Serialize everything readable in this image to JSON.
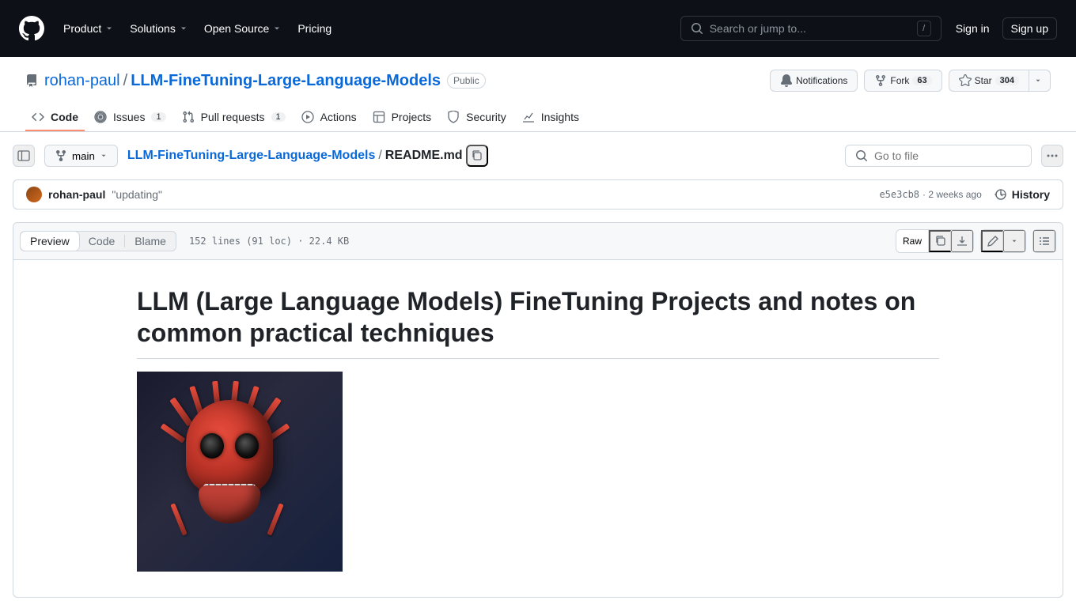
{
  "header": {
    "nav": [
      "Product",
      "Solutions",
      "Open Source",
      "Pricing"
    ],
    "search_placeholder": "Search or jump to...",
    "search_key": "/",
    "signin": "Sign in",
    "signup": "Sign up"
  },
  "repo": {
    "owner": "rohan-paul",
    "name": "LLM-FineTuning-Large-Language-Models",
    "visibility": "Public",
    "actions": {
      "notifications": "Notifications",
      "fork": "Fork",
      "fork_count": "63",
      "star": "Star",
      "star_count": "304"
    }
  },
  "tabs": [
    {
      "label": "Code",
      "icon": "code",
      "active": true
    },
    {
      "label": "Issues",
      "icon": "issue",
      "count": "1"
    },
    {
      "label": "Pull requests",
      "icon": "pr",
      "count": "1"
    },
    {
      "label": "Actions",
      "icon": "play"
    },
    {
      "label": "Projects",
      "icon": "table"
    },
    {
      "label": "Security",
      "icon": "shield"
    },
    {
      "label": "Insights",
      "icon": "graph"
    }
  ],
  "filenav": {
    "branch": "main",
    "breadcrumb_root": "LLM-FineTuning-Large-Language-Models",
    "breadcrumb_current": "README.md",
    "goto_placeholder": "Go to file"
  },
  "commit": {
    "author": "rohan-paul",
    "message": "\"updating\"",
    "sha": "e5e3cb8",
    "time": "2 weeks ago",
    "history": "History"
  },
  "filetoolbar": {
    "views": [
      "Preview",
      "Code",
      "Blame"
    ],
    "info": "152 lines (91 loc) · 22.4 KB",
    "raw": "Raw"
  },
  "markdown": {
    "h1": "LLM (Large Language Models) FineTuning Projects and notes on common practical techniques"
  }
}
